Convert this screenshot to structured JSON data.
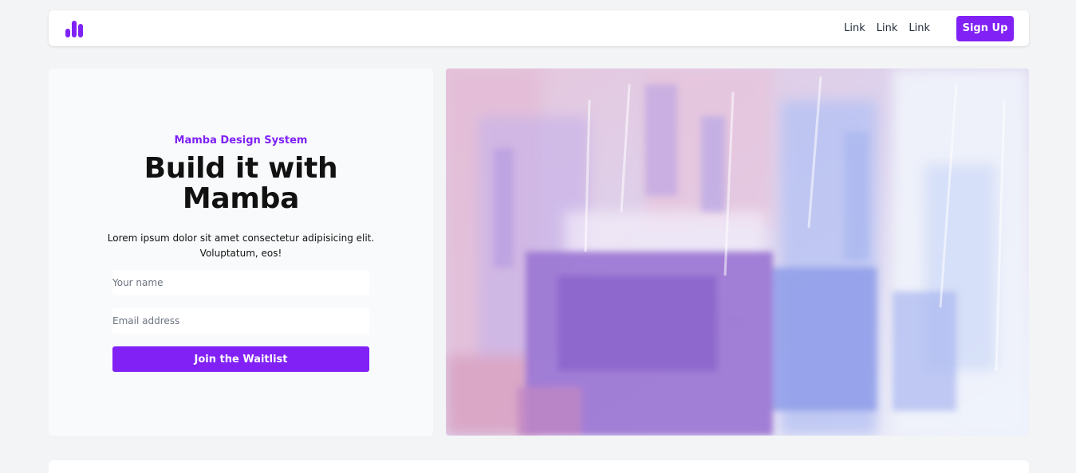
{
  "nav": {
    "logo_icon": "bar-chart-logo-icon",
    "links": [
      "Link",
      "Link",
      "Link"
    ],
    "signup_label": "Sign Up"
  },
  "hero": {
    "eyebrow": "Mamba Design System",
    "headline_line1": "Build it with",
    "headline_line2": "Mamba",
    "lede_line1": "Lorem ipsum dolor sit amet consectetur adipisicing elit.",
    "lede_line2": "Voluptatum, eos!",
    "name_placeholder": "Your name",
    "email_placeholder": "Email address",
    "cta_label": "Join the Waitlist"
  },
  "colors": {
    "accent": "#8121f5",
    "page_bg": "#f3f4f6",
    "panel_bg": "#f9fafb"
  },
  "image": {
    "description_icon": "abstract-paint-image"
  }
}
